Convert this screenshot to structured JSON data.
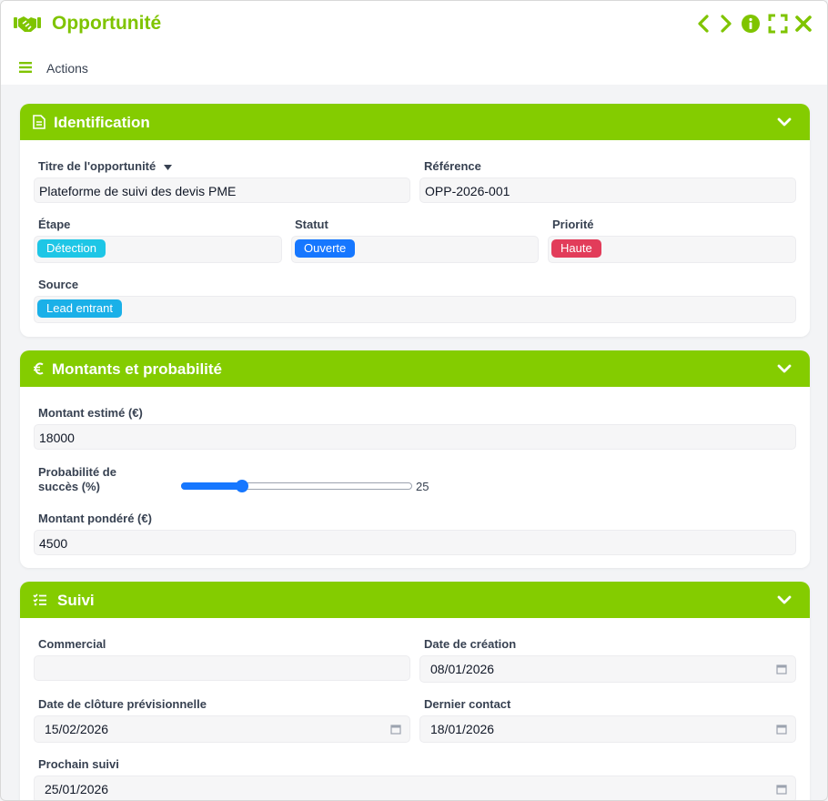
{
  "window": {
    "title": "Opportunité",
    "accent": "#84cc00",
    "title_color": "#7fc400",
    "buttons": [
      "chevron-left-icon",
      "chevron-right-icon",
      "info-icon",
      "fullscreen-icon",
      "close-icon"
    ]
  },
  "toolbar": {
    "actions_label": "Actions",
    "menu_icon": "hamburger-icon"
  },
  "identification": {
    "header": "Identification",
    "icon": "document-icon",
    "titre_label": "Titre de l'opportunité",
    "titre_value": "Plateforme de suivi des devis PME",
    "reference_label": "Référence",
    "reference_value": "OPP-2026-001",
    "etape_label": "Étape",
    "etape_value": "Détection",
    "etape_color": "#1ec6e6",
    "statut_label": "Statut",
    "statut_value": "Ouverte",
    "statut_color": "#1677ff",
    "priorite_label": "Priorité",
    "priorite_value": "Haute",
    "priorite_color": "#e23c5a",
    "source_label": "Source",
    "source_value": "Lead entrant",
    "source_color": "#1ab0e8"
  },
  "montants": {
    "header": "Montants et probabilité",
    "icon": "euro-icon",
    "montant_estime_label": "Montant estimé (€)",
    "montant_estime_value": "18000",
    "probabilite_label_line1": "Probabilité de",
    "probabilite_label_line2": "succès (%)",
    "probabilite_value": "25",
    "probabilite_fraction": 0.25,
    "montant_pondere_label": "Montant pondéré (€)",
    "montant_pondere_value": "4500"
  },
  "suivi": {
    "header": "Suivi",
    "icon": "checklist-icon",
    "commercial_label": "Commercial",
    "commercial_value": "",
    "date_creation_label": "Date de création",
    "date_creation_value": "08/01/2026",
    "date_cloture_label": "Date de clôture prévisionnelle",
    "date_cloture_value": "15/02/2026",
    "dernier_contact_label": "Dernier contact",
    "dernier_contact_value": "18/01/2026",
    "prochain_suivi_label": "Prochain suivi",
    "prochain_suivi_value": "25/01/2026"
  }
}
